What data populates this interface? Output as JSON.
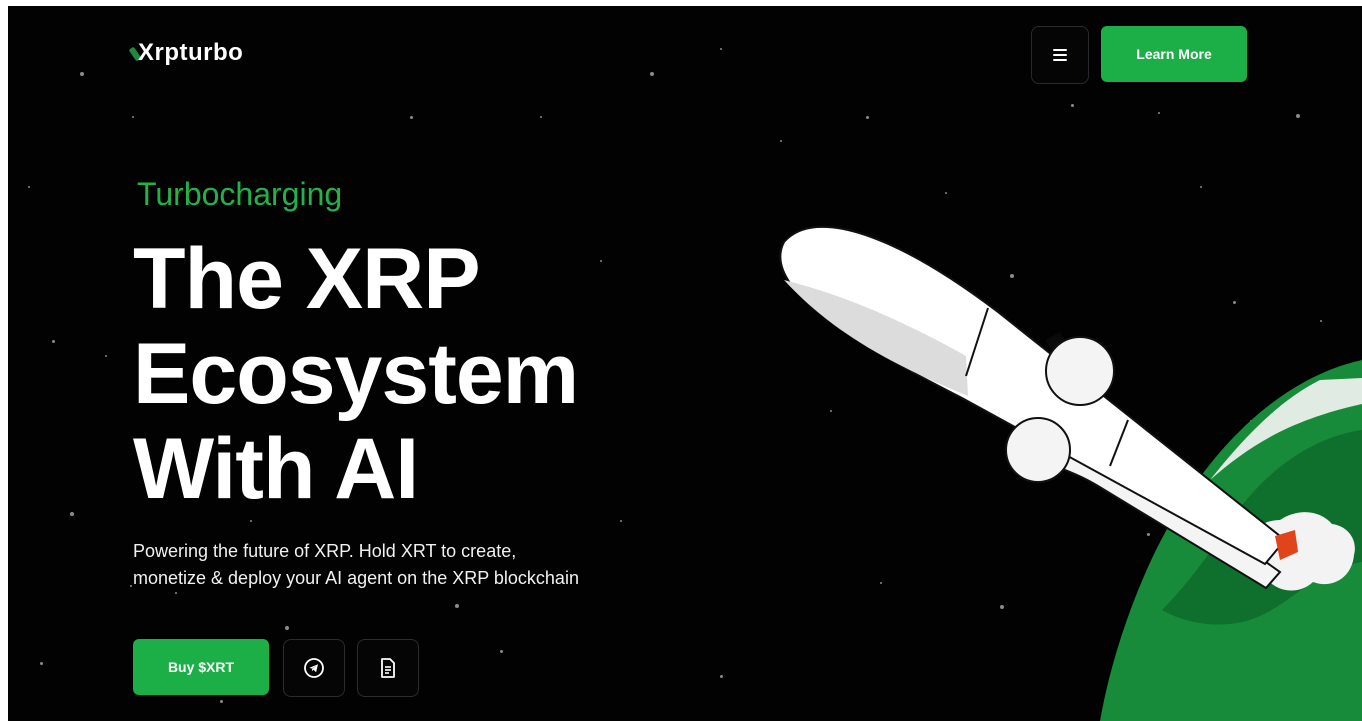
{
  "header": {
    "logo_text": "Xrpturbo",
    "menu_icon": "menu-icon",
    "learn_more_label": "Learn More"
  },
  "hero": {
    "eyebrow": "Turbocharging",
    "headline_lines": [
      "The XRP",
      "Ecosystem",
      "With AI"
    ],
    "subtitle_lines": [
      "Powering the future of XRP. Hold XRT to create,",
      "monetize & deploy your AI agent on the XRP blockchain"
    ],
    "buy_label": "Buy $XRT",
    "telegram_icon": "telegram-icon",
    "document_icon": "document-icon"
  },
  "colors": {
    "accent": "#1cae47",
    "eyebrow": "#23b249",
    "background": "#020202"
  }
}
